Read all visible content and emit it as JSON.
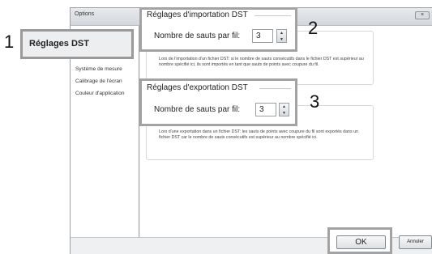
{
  "window": {
    "title": "Options",
    "close_glyph": "×"
  },
  "sidebar": {
    "selected_label": "Réglages DST",
    "items": [
      {
        "label": "Système de mesure"
      },
      {
        "label": "Calibrage de l'écran"
      },
      {
        "label": "Couleur d'application"
      }
    ]
  },
  "import_settings": {
    "title": "Réglages d'importation DST",
    "field_label": "Nombre de sauts par fil:",
    "value": "3",
    "description": "Lors de l'importation d'un fichier DST: si le nombre de sauts consécutifs dans le fichier DST est supérieur au nombre spécifié ici, ils sont importés en tant que sauts de points avec coupure du fil."
  },
  "export_settings": {
    "title": "Réglages d'exportation DST",
    "field_label": "Nombre de sauts par fil:",
    "value": "3",
    "description": "Lors d'une exportation dans un fichier DST: les sauts de points avec coupure du fil sont exportés dans un fichier DST car le nombre de sauts consécutifs est supérieur au nombre spécifié ici."
  },
  "callouts": {
    "one": "1",
    "two": "2",
    "three": "3"
  },
  "buttons": {
    "ok": "OK",
    "cancel": "Annuler"
  },
  "icons": {
    "spin_up": "up-arrow-icon",
    "spin_down": "down-arrow-icon"
  }
}
